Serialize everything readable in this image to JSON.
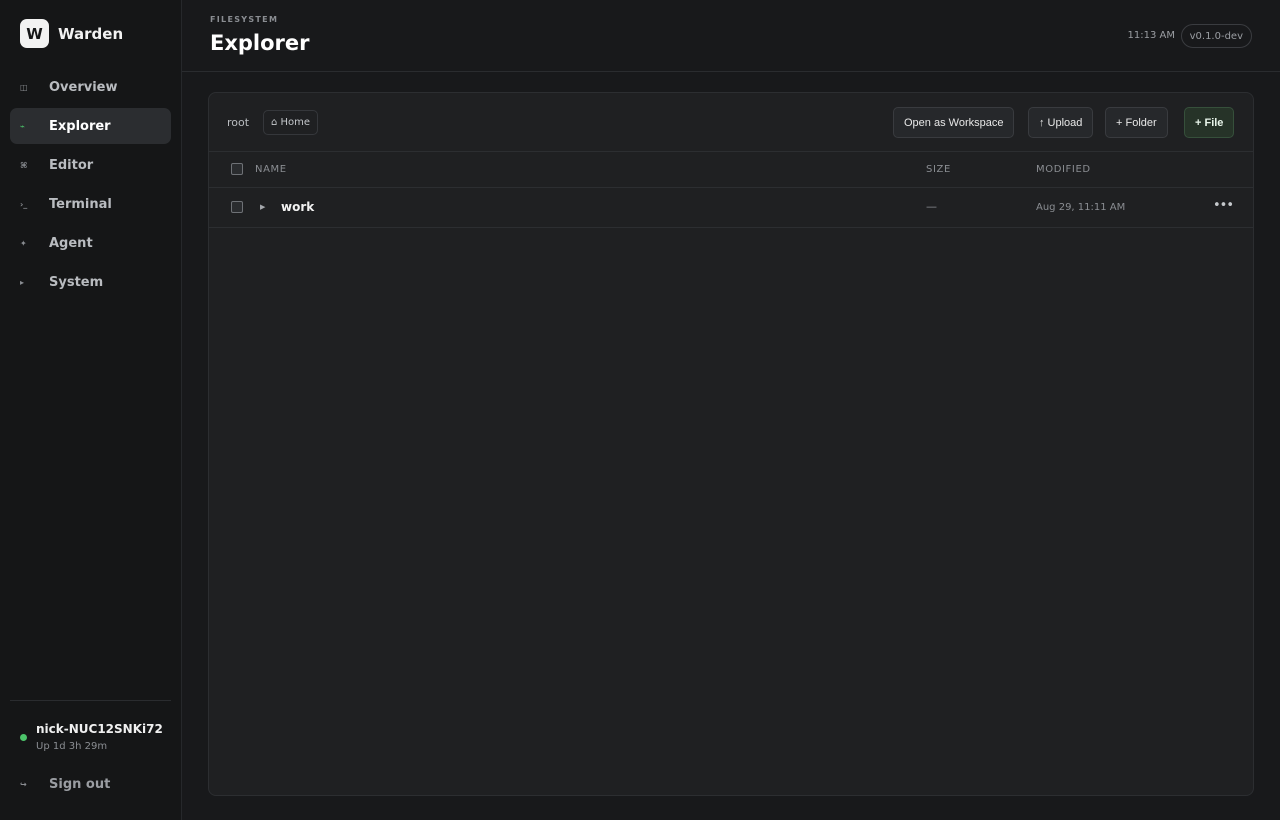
{
  "app": {
    "logo_letter": "W",
    "name": "Warden"
  },
  "sidebar": {
    "items": [
      {
        "label": "Overview",
        "icon": "◫",
        "icon_name": "overview-icon"
      },
      {
        "label": "Explorer",
        "icon": "⌁",
        "icon_name": "explorer-icon",
        "active": true
      },
      {
        "label": "Editor",
        "icon": "⌘",
        "icon_name": "editor-icon"
      },
      {
        "label": "Terminal",
        "icon": "›_",
        "icon_name": "terminal-icon"
      },
      {
        "label": "Agent",
        "icon": "✦",
        "icon_name": "agent-icon"
      },
      {
        "label": "System",
        "icon": "▸",
        "icon_name": "system-icon"
      }
    ],
    "host": {
      "name": "nick-NUC12SNKi72",
      "uptime": "Up 1d 3h 29m",
      "status_color": "#4cc46a"
    },
    "signout": {
      "label": "Sign out",
      "icon": "↪",
      "icon_name": "sign-out-icon"
    }
  },
  "header": {
    "eyebrow": "FILESYSTEM",
    "title": "Explorer",
    "time": "11:13 AM",
    "version": "v0.1.0-dev"
  },
  "toolbar": {
    "breadcrumb_root": "root",
    "home_label": "⌂ Home",
    "workspace_label": "Open as Workspace",
    "upload_label": "↑ Upload",
    "folder_label": "+ Folder",
    "file_label": "+ File"
  },
  "table": {
    "columns": {
      "name": "NAME",
      "size": "SIZE",
      "modified": "MODIFIED"
    },
    "rows": [
      {
        "name": "work",
        "size": "—",
        "modified": "Aug 29, 11:11 AM",
        "type": "folder"
      }
    ]
  },
  "colors": {
    "accent": "#4cc46a",
    "background": "#18191b",
    "panel": "#1f2022"
  }
}
